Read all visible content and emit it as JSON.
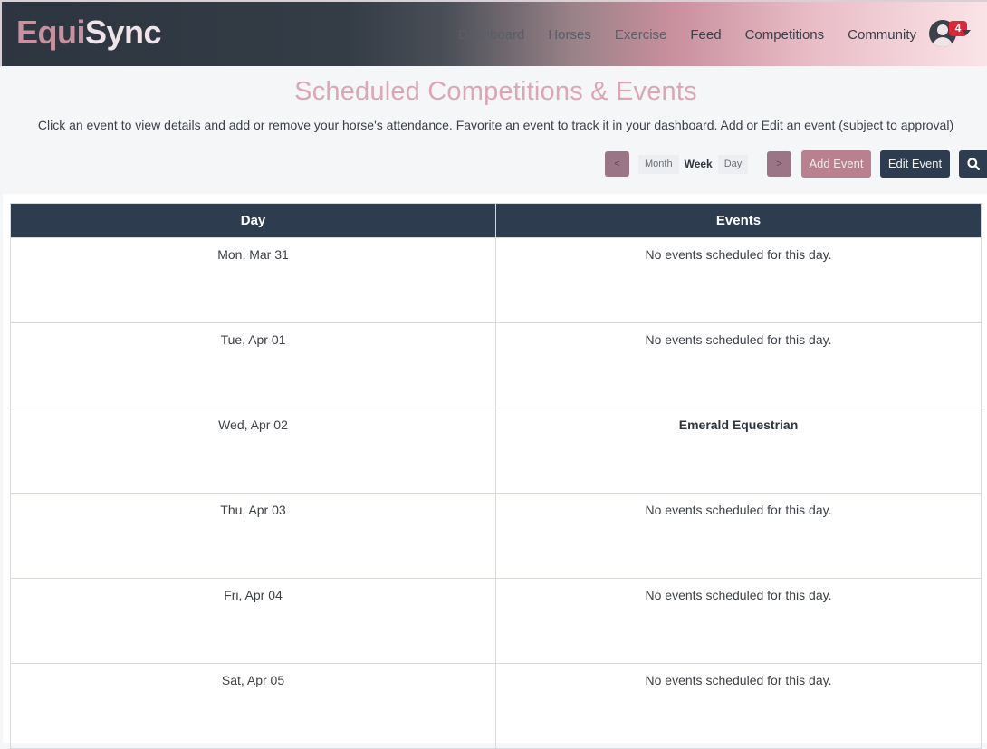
{
  "brand": {
    "part1": "Equi",
    "part2": "Sync"
  },
  "nav": {
    "links": [
      "Dashboard",
      "Horses",
      "Exercise",
      "Feed",
      "Competitions",
      "Community"
    ],
    "notification_count": "4"
  },
  "page": {
    "title": "Scheduled Competitions & Events",
    "subtitle": "Click an event to view details and add or remove your horse's attendance. Favorite an event to track it in your dashboard. Add or Edit an event (subject to approval)"
  },
  "toolbar": {
    "prev_label": "<",
    "next_label": ">",
    "views": [
      "Month",
      "Week",
      "Day"
    ],
    "active_view": "Week",
    "add_event_label": "Add Event",
    "edit_event_label": "Edit Event"
  },
  "table": {
    "headers": [
      "Day",
      "Events"
    ],
    "rows": [
      {
        "day": "Mon, Mar 31",
        "events": "No events scheduled for this day."
      },
      {
        "day": "Tue, Apr 01",
        "events": "No events scheduled for this day."
      },
      {
        "day": "Wed, Apr 02",
        "events": "Emerald Equestrian"
      },
      {
        "day": "Thu, Apr 03",
        "events": "No events scheduled for this day."
      },
      {
        "day": "Fri, Apr 04",
        "events": "No events scheduled for this day."
      },
      {
        "day": "Sat, Apr 05",
        "events": "No events scheduled for this day."
      }
    ]
  },
  "colors": {
    "accent_pink": "#dba7b4",
    "nav_dark": "#2d3d4f",
    "button_mauve": "#b9808f",
    "badge_red": "#d9283a"
  },
  "icons": [
    "user-avatar-icon",
    "chevron-down-icon",
    "search-icon"
  ]
}
